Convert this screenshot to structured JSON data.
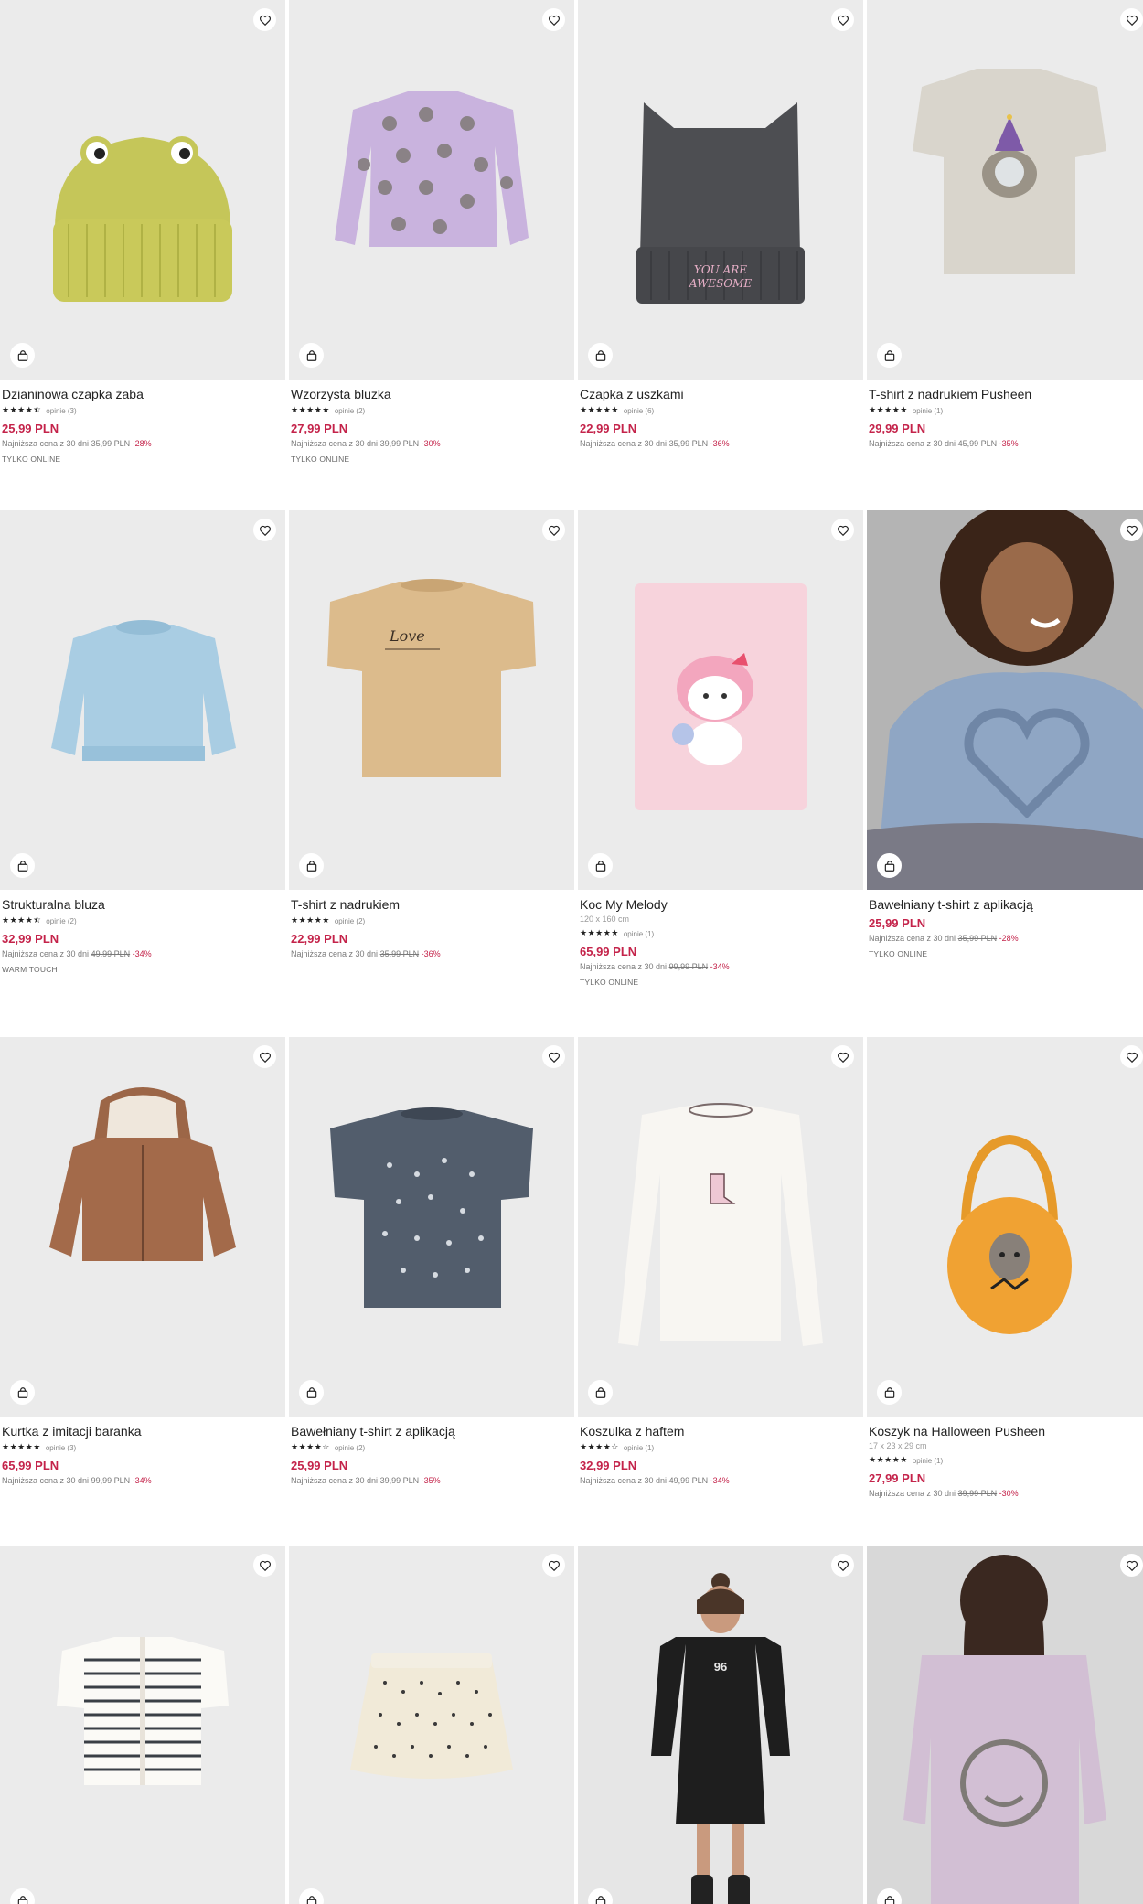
{
  "products": [
    {
      "name": "Dzianinowa czapka żaba",
      "size": "",
      "stars": "★★★★⯪",
      "reviews": "opinie (3)",
      "price": "25,99 PLN",
      "lowest_label": "Najniższa cena z 30 dni",
      "old_price": "35,99 PLN",
      "discount": "-28%",
      "tag": "TYLKO ONLINE",
      "bg": "#ebebeb",
      "art": "frog-hat-image"
    },
    {
      "name": "Wzorzysta bluzka",
      "size": "",
      "stars": "★★★★★",
      "reviews": "opinie (2)",
      "price": "27,99 PLN",
      "lowest_label": "Najniższa cena z 30 dni",
      "old_price": "39,99 PLN",
      "discount": "-30%",
      "tag": "TYLKO ONLINE",
      "bg": "#ebebeb",
      "art": "polka-dot-sweater-image"
    },
    {
      "name": "Czapka z uszkami",
      "size": "",
      "stars": "★★★★★",
      "reviews": "opinie (6)",
      "price": "22,99 PLN",
      "lowest_label": "Najniższa cena z 30 dni",
      "old_price": "35,99 PLN",
      "discount": "-36%",
      "tag": "",
      "bg": "#ebebeb",
      "art": "ear-beanie-image",
      "print": "YOU ARE AWESOME"
    },
    {
      "name": "T-shirt z nadrukiem Pusheen",
      "size": "",
      "stars": "★★★★★",
      "reviews": "opinie (1)",
      "price": "29,99 PLN",
      "lowest_label": "Najniższa cena z 30 dni",
      "old_price": "45,99 PLN",
      "discount": "-35%",
      "tag": "",
      "bg": "#ebebeb",
      "art": "pusheen-tshirt-image"
    },
    {
      "name": "Strukturalna bluza",
      "size": "",
      "stars": "★★★★⯪",
      "reviews": "opinie (2)",
      "price": "32,99 PLN",
      "lowest_label": "Najniższa cena z 30 dni",
      "old_price": "49,99 PLN",
      "discount": "-34%",
      "tag": "WARM TOUCH",
      "bg": "#ebebeb",
      "art": "blue-sweatshirt-image"
    },
    {
      "name": "T-shirt z nadrukiem",
      "size": "",
      "stars": "★★★★★",
      "reviews": "opinie (2)",
      "price": "22,99 PLN",
      "lowest_label": "Najniższa cena z 30 dni",
      "old_price": "35,99 PLN",
      "discount": "-36%",
      "tag": "",
      "bg": "#ebebeb",
      "art": "beige-tshirt-image",
      "print": "Love"
    },
    {
      "name": "Koc My Melody",
      "size": "120 x 160 cm",
      "stars": "★★★★★",
      "reviews": "opinie (1)",
      "price": "65,99 PLN",
      "lowest_label": "Najniższa cena z 30 dni",
      "old_price": "99,99 PLN",
      "discount": "-34%",
      "tag": "TYLKO ONLINE",
      "bg": "#ebebeb",
      "art": "my-melody-blanket-image"
    },
    {
      "name": "Bawełniany t-shirt z aplikacją",
      "size": "",
      "stars": "",
      "reviews": "",
      "price": "25,99 PLN",
      "lowest_label": "Najniższa cena z 30 dni",
      "old_price": "35,99 PLN",
      "discount": "-28%",
      "tag": "TYLKO ONLINE",
      "bg": "#a8a8a8",
      "art": "girl-heart-tshirt-photo"
    },
    {
      "name": "Kurtka z imitacji baranka",
      "size": "",
      "stars": "★★★★★",
      "reviews": "opinie (3)",
      "price": "65,99 PLN",
      "lowest_label": "Najniższa cena z 30 dni",
      "old_price": "99,99 PLN",
      "discount": "-34%",
      "tag": "",
      "bg": "#ebebeb",
      "art": "teddy-jacket-image"
    },
    {
      "name": "Bawełniany t-shirt z aplikacją",
      "size": "",
      "stars": "★★★★☆",
      "reviews": "opinie (2)",
      "price": "25,99 PLN",
      "lowest_label": "Najniższa cena z 30 dni",
      "old_price": "39,99 PLN",
      "discount": "-35%",
      "tag": "",
      "bg": "#ebebeb",
      "art": "navy-tshirt-image"
    },
    {
      "name": "Koszulka z haftem",
      "size": "",
      "stars": "★★★★☆",
      "reviews": "opinie (1)",
      "price": "32,99 PLN",
      "lowest_label": "Najniższa cena z 30 dni",
      "old_price": "49,99 PLN",
      "discount": "-34%",
      "tag": "",
      "bg": "#ebebeb",
      "art": "white-longsleeve-image"
    },
    {
      "name": "Koszyk na Halloween Pusheen",
      "size": "17 x 23 x 29 cm",
      "stars": "★★★★★",
      "reviews": "opinie (1)",
      "price": "27,99 PLN",
      "lowest_label": "Najniższa cena z 30 dni",
      "old_price": "39,99 PLN",
      "discount": "-30%",
      "tag": "",
      "bg": "#ebebeb",
      "art": "halloween-basket-image"
    },
    {
      "name": "",
      "size": "",
      "stars": "",
      "reviews": "",
      "price": "",
      "lowest_label": "",
      "old_price": "",
      "discount": "",
      "tag": "",
      "bg": "#ebebeb",
      "art": "striped-tshirt-image"
    },
    {
      "name": "",
      "size": "",
      "stars": "",
      "reviews": "",
      "price": "",
      "lowest_label": "",
      "old_price": "",
      "discount": "",
      "tag": "",
      "bg": "#ebebeb",
      "art": "tulle-skirt-image"
    },
    {
      "name": "",
      "size": "",
      "stars": "",
      "reviews": "",
      "price": "",
      "lowest_label": "",
      "old_price": "",
      "discount": "",
      "tag": "",
      "bg": "#e6e6e6",
      "art": "girl-black-dress-photo",
      "print": "96"
    },
    {
      "name": "",
      "size": "",
      "stars": "",
      "reviews": "",
      "price": "",
      "lowest_label": "",
      "old_price": "",
      "discount": "",
      "tag": "",
      "bg": "#d8d8d8",
      "art": "girl-pink-tshirt-photo"
    }
  ],
  "colors": {
    "price": "#c4234a",
    "image_bg": "#ebebeb"
  },
  "icons": {
    "favorite": "heart-icon",
    "add_to_cart": "shopping-bag-icon"
  }
}
